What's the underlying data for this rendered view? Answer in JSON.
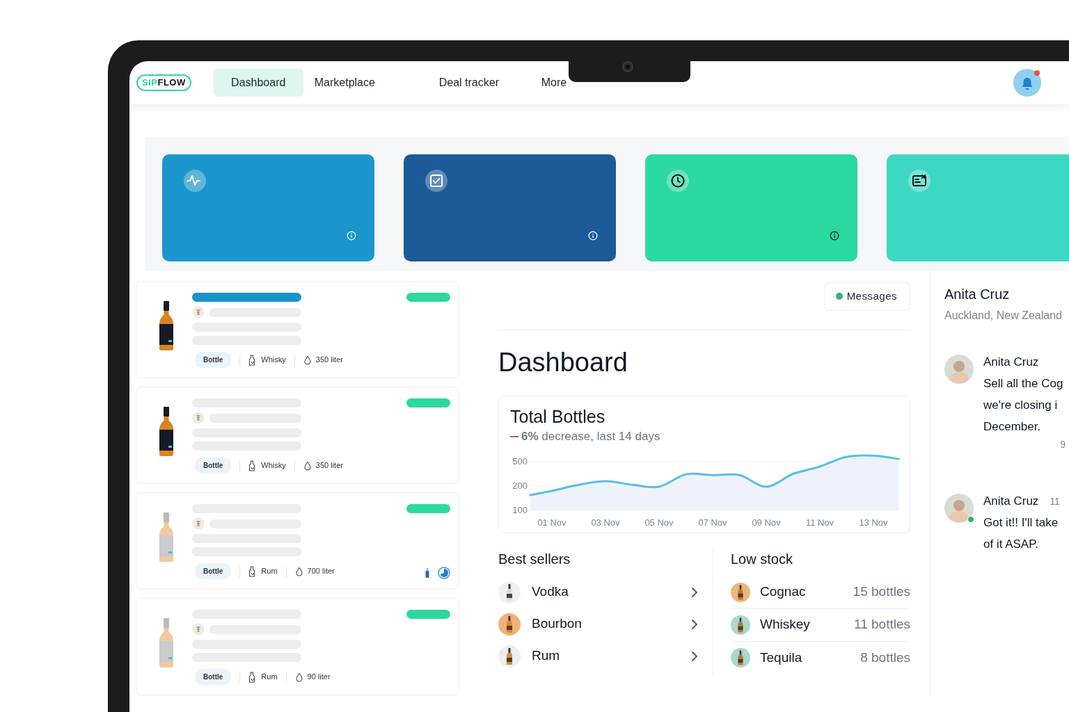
{
  "nav": {
    "logo": {
      "prefix": "SIP",
      "suffix": "FLOW"
    },
    "tabs": [
      {
        "label": "Dashboard",
        "selected": true
      },
      {
        "label": "Marketplace",
        "selected": false
      },
      {
        "label": "Deal tracker",
        "selected": false
      },
      {
        "label": "More",
        "selected": false
      }
    ],
    "notification": true
  },
  "stat_cards": [
    {
      "kind": "activity",
      "color": "#1a96cc"
    },
    {
      "kind": "check",
      "color": "#1c5b98"
    },
    {
      "kind": "clock",
      "color": "#2bd9a0"
    },
    {
      "kind": "screen",
      "color": "#3dd8c4"
    }
  ],
  "products": [
    {
      "selected": true,
      "kind": "dark",
      "tag": "Bottle",
      "category": "Whisky",
      "volume": "350 liter",
      "indicators": false
    },
    {
      "selected": false,
      "kind": "dark",
      "tag": "Bottle",
      "category": "Whisky",
      "volume": "350 liter",
      "indicators": false
    },
    {
      "selected": false,
      "kind": "clear",
      "tag": "Bottle",
      "category": "Rum",
      "volume": "700 liter",
      "indicators": true
    },
    {
      "selected": false,
      "kind": "clear",
      "tag": "Bottle",
      "category": "Rum",
      "volume": "90 liter",
      "indicators": false
    }
  ],
  "messages_button": {
    "label": "Messages",
    "online": true
  },
  "page_title": "Dashboard",
  "total_bottles": {
    "title": "Total Bottles",
    "summary": "**6%** decrease, last 14 days",
    "y_labels": [
      "500",
      "200",
      "100"
    ],
    "x_labels": [
      "01 Nov",
      "03 Nov",
      "05 Nov",
      "07 Nov",
      "09 Nov",
      "11 Nov",
      "13 Nov"
    ]
  },
  "best_sellers": {
    "title": "Best sellers",
    "items": [
      {
        "name": "Vodka",
        "color": "#eef1f4"
      },
      {
        "name": "Bourbon",
        "color": "#f0b27a"
      },
      {
        "name": "Rum",
        "color": "#eeeeee"
      }
    ]
  },
  "low_stock": {
    "title": "Low stock",
    "items": [
      {
        "name": "Cognac",
        "count": "15 bottles",
        "color": "#e8b87c"
      },
      {
        "name": "Whiskey",
        "count": "11 bottles",
        "color": "#a9d8cf"
      },
      {
        "name": "Tequila",
        "count": "8 bottles",
        "color": "#a9d8cf"
      }
    ]
  },
  "contact": {
    "name": "Anita Cruz",
    "location": "Auckland, New Zealand"
  },
  "chat": [
    {
      "author": "Anita Cruz",
      "time": "9",
      "time_below": true,
      "online": false,
      "text": "Sell all the Cog\nwe're closing i\nDecember."
    },
    {
      "author": "Anita Cruz",
      "time": "11",
      "time_below": false,
      "online": true,
      "text": "Got it!! I'll take\nof it ASAP."
    }
  ]
}
